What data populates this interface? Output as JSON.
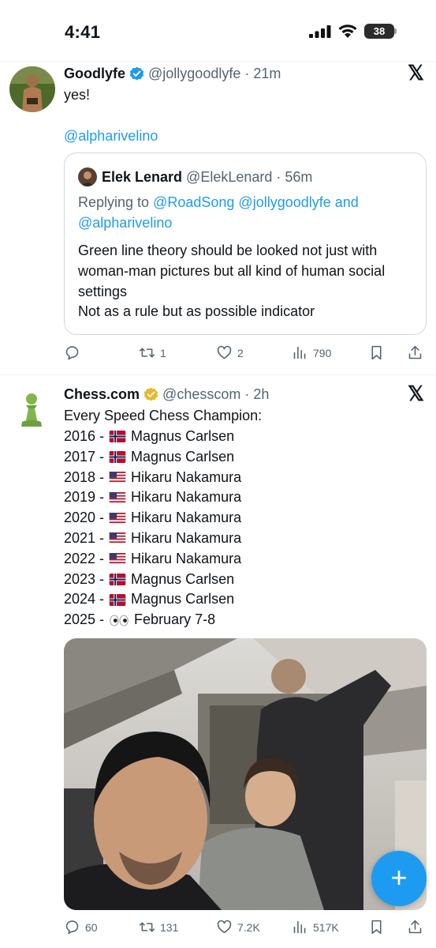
{
  "status": {
    "time": "4:41",
    "battery": "38"
  },
  "tweet1": {
    "name": "Goodlyfe",
    "handle": "@jollygoodlyfe",
    "time": "· 21m",
    "text": "yes!",
    "mention": "@alpharivelino",
    "quote": {
      "name": "Elek Lenard",
      "handle": "@ElekLenard",
      "time": "· 56m",
      "reply_prefix": "Replying to ",
      "reply_to_1": "@RoadSong",
      "reply_to_2": "@jollygoodlyfe",
      "reply_and": " and",
      "reply_to_3": "@alpharivelino",
      "text": "Green line theory should be looked not just with woman-man pictures but all kind of human social settings\nNot as a rule but as possible indicator"
    },
    "actions": {
      "replies": "",
      "reposts": "1",
      "likes": "2",
      "views": "790"
    }
  },
  "tweet2": {
    "name": "Chess.com",
    "handle": "@chesscom",
    "time": "· 2h",
    "heading": "Every Speed Chess Champion:",
    "champions": [
      {
        "year": "2016 -",
        "flag": "norway",
        "champion": "Magnus Carlsen"
      },
      {
        "year": "2017 -",
        "flag": "norway",
        "champion": "Magnus Carlsen"
      },
      {
        "year": "2018 -",
        "flag": "usa",
        "champion": "Hikaru Nakamura"
      },
      {
        "year": "2019 -",
        "flag": "usa",
        "champion": "Hikaru Nakamura"
      },
      {
        "year": "2020 -",
        "flag": "usa",
        "champion": "Hikaru Nakamura"
      },
      {
        "year": "2021 -",
        "flag": "usa",
        "champion": "Hikaru Nakamura"
      },
      {
        "year": "2022 -",
        "flag": "usa",
        "champion": "Hikaru Nakamura"
      },
      {
        "year": "2023 -",
        "flag": "norway",
        "champion": "Magnus Carlsen"
      },
      {
        "year": "2024 -",
        "flag": "norway",
        "champion": "Magnus Carlsen"
      },
      {
        "year": "2025 -",
        "flag": "eyes",
        "champion": "February 7-8"
      }
    ],
    "actions": {
      "replies": "60",
      "reposts": "131",
      "likes": "7.2K",
      "views": "517K"
    }
  },
  "colors": {
    "accent": "#1d9bf0",
    "verified_blue": "#1d9bf0",
    "verified_gold": "#e8b829",
    "text_secondary": "#536471"
  }
}
